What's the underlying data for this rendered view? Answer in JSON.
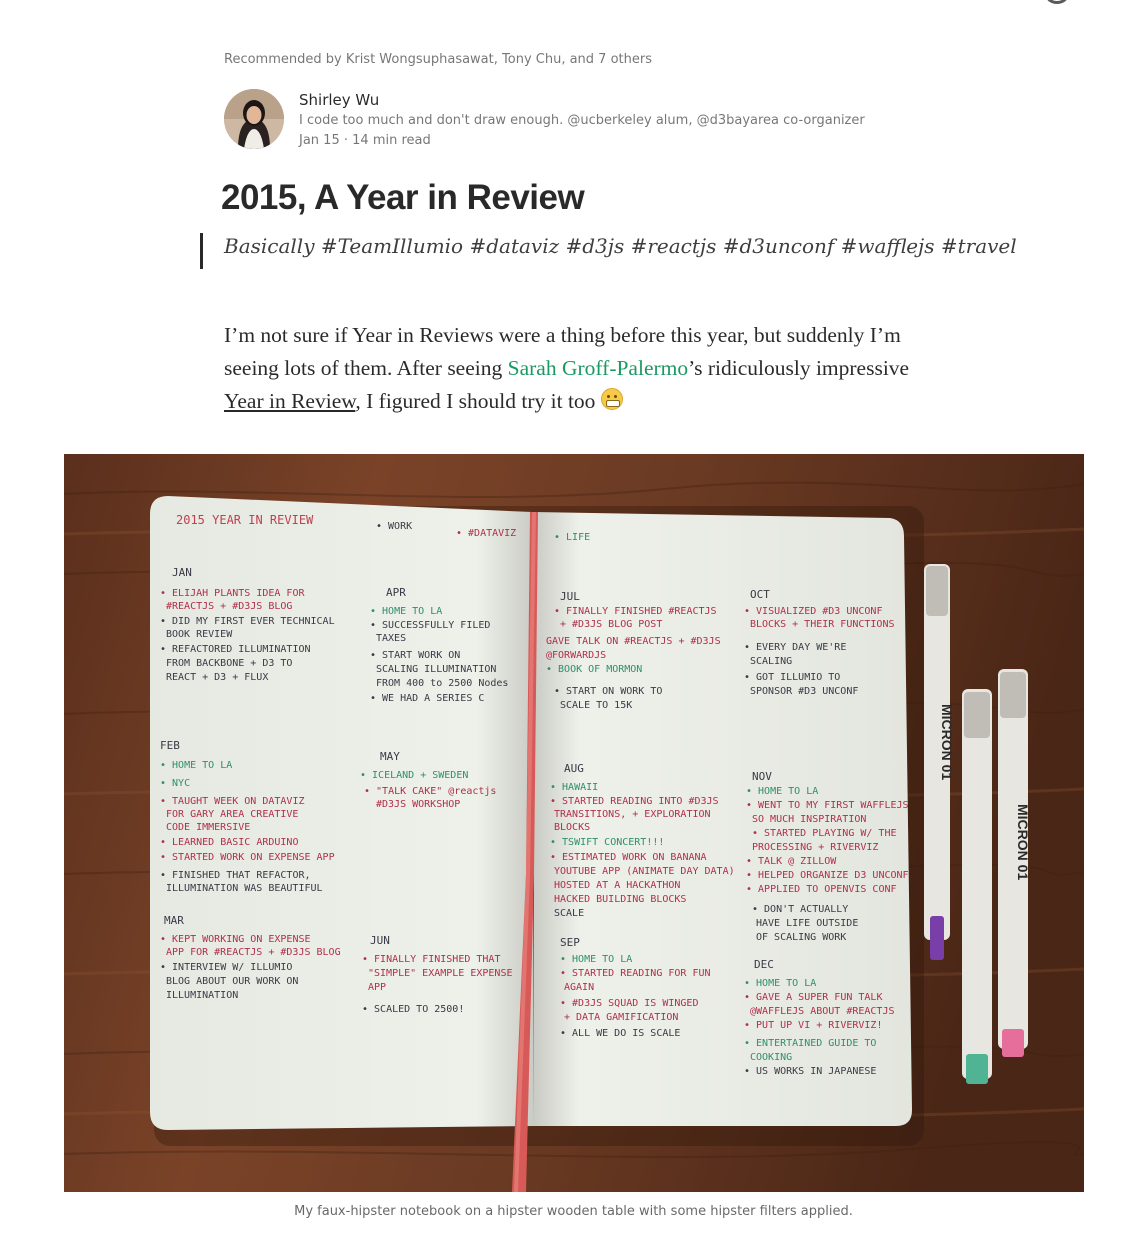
{
  "recommended": "Recommended by Krist Wongsuphasawat, Tony Chu, and 7 others",
  "author": {
    "name": "Shirley Wu",
    "bio": "I code too much and don't draw enough. @ucberkeley alum, @d3bayarea co-organizer",
    "date": "Jan 15",
    "separator": "·",
    "read_time": "14 min read"
  },
  "article": {
    "title": "2015, A Year in Review",
    "subtitle": "Basically #TeamIllumio #dataviz #d3js #reactjs #d3unconf #wafflejs #travel",
    "paragraph": {
      "part1": "I’m not sure if Year in Reviews were a thing before this year, but suddenly I’m seeing lots of them. After seeing ",
      "link1": "Sarah Groff-Palermo",
      "part2": "’s ridiculously impressive ",
      "link2": "Year in Review",
      "part3": ", I figured I should try it too "
    }
  },
  "figure": {
    "caption": "My faux-hipster notebook on a hipster wooden table with some hipster filters applied.",
    "notebook_left": {
      "header": "2015 YEAR IN REVIEW",
      "columns_top": [
        "• WORK",
        "• #DATAVIZ",
        "• LIFE"
      ],
      "months": [
        "JAN",
        "FEB",
        "MAR",
        "APR",
        "MAY",
        "JUN"
      ]
    },
    "notebook_right": {
      "months": [
        "JUL",
        "AUG",
        "SEP",
        "OCT",
        "NOV",
        "DEC"
      ]
    },
    "pen_label": "MICRON 01"
  },
  "colors": {
    "link_green": "#1c9963",
    "ink_red": "#b0304a",
    "ink_green": "#2e8f6a",
    "wood": "#6b3a22"
  }
}
